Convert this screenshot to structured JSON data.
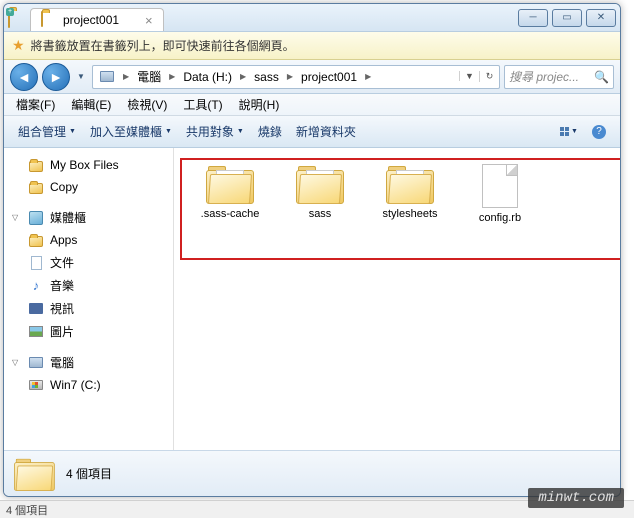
{
  "window": {
    "tab_title": "project001",
    "info_bar": "將書籤放置在書籤列上，即可快速前往各個網頁。"
  },
  "breadcrumb": {
    "items": [
      "電腦",
      "Data (H:)",
      "sass",
      "project001"
    ]
  },
  "search": {
    "placeholder": "搜尋 projec..."
  },
  "menu": {
    "file": "檔案(F)",
    "edit": "編輯(E)",
    "view": "檢視(V)",
    "tools": "工具(T)",
    "help": "說明(H)"
  },
  "toolbar": {
    "organize": "組合管理",
    "include": "加入至媒體櫃",
    "share": "共用對象",
    "burn": "燒錄",
    "new_folder": "新增資料夾"
  },
  "sidebar": {
    "items_top": [
      {
        "label": "My Box Files"
      },
      {
        "label": "Copy"
      }
    ],
    "group_lib": "媒體櫃",
    "lib_items": [
      {
        "label": "Apps"
      },
      {
        "label": "文件"
      },
      {
        "label": "音樂"
      },
      {
        "label": "視訊"
      },
      {
        "label": "圖片"
      }
    ],
    "group_comp": "電腦",
    "comp_items": [
      {
        "label": "Win7 (C:)"
      }
    ]
  },
  "files": [
    {
      "name": ".sass-cache",
      "type": "folder"
    },
    {
      "name": "sass",
      "type": "folder"
    },
    {
      "name": "stylesheets",
      "type": "folder"
    },
    {
      "name": "config.rb",
      "type": "file"
    }
  ],
  "status": {
    "count_detail": "4 個項目",
    "count_bottom": "4 個項目"
  },
  "watermark": "minwt.com"
}
